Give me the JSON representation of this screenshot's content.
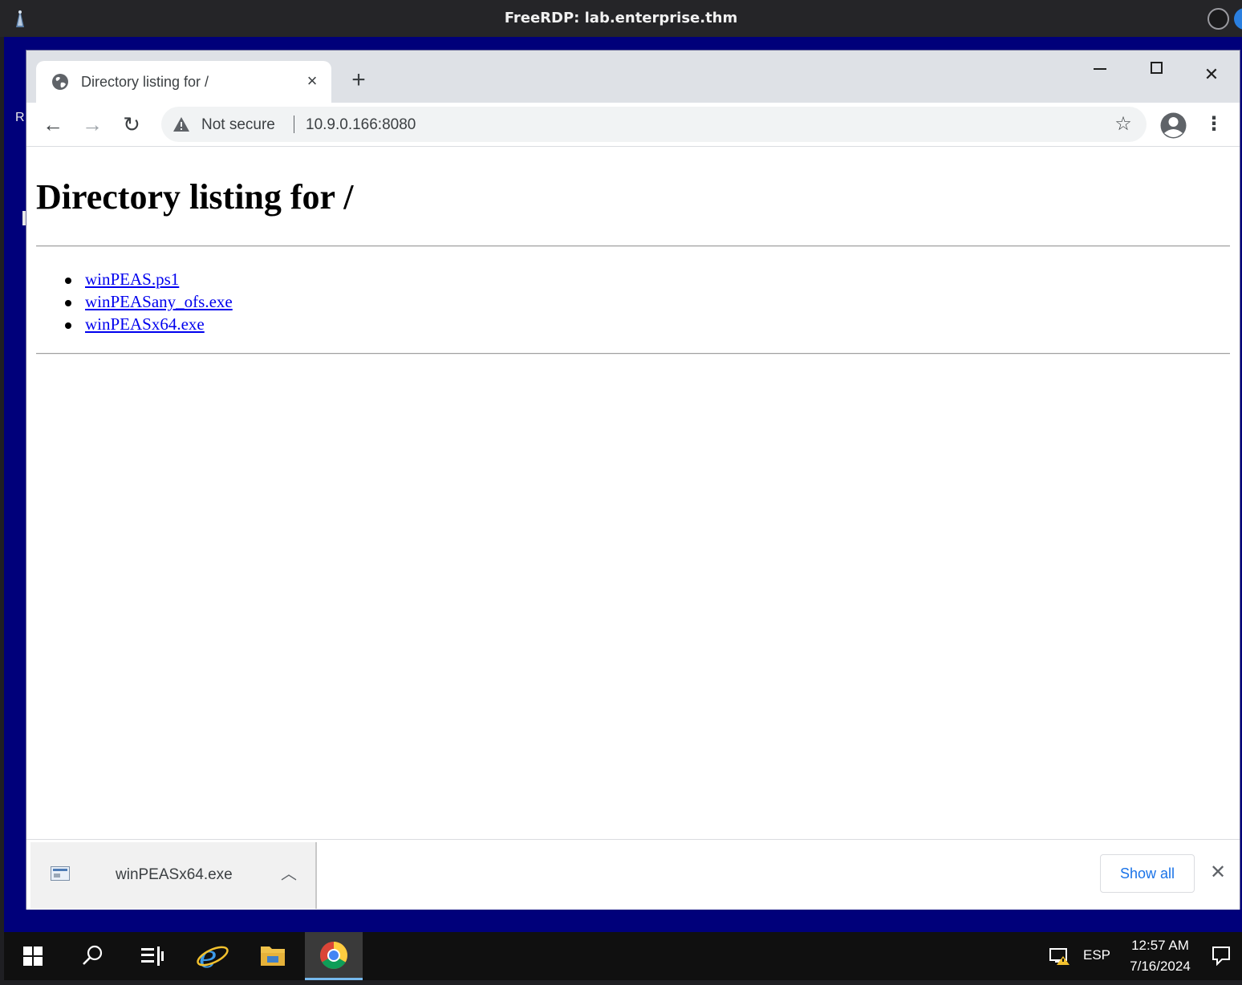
{
  "rdp": {
    "title": "FreeRDP: lab.enterprise.thm"
  },
  "desktop": {
    "edge_glyph": "R"
  },
  "browser": {
    "tab": {
      "title": "Directory listing for /",
      "icon": "globe-icon"
    },
    "window_controls": [
      "minimize",
      "maximize",
      "close"
    ],
    "address_bar": {
      "security_label": "Not secure",
      "url": "10.9.0.166:8080"
    }
  },
  "page": {
    "heading": "Directory listing for /",
    "files": [
      "winPEAS.ps1",
      "winPEASany_ofs.exe",
      "winPEASx64.exe"
    ]
  },
  "download_shelf": {
    "item": {
      "filename": "winPEASx64.exe",
      "icon": "exe-file-icon"
    },
    "show_all_label": "Show all"
  },
  "taskbar": {
    "apps": [
      "start-icon",
      "search-icon",
      "task-view-icon",
      "internet-explorer-icon",
      "file-explorer-icon",
      "chrome-icon"
    ],
    "active_app": "chrome",
    "language": "ESP",
    "time": "12:57 AM",
    "date": "7/16/2024"
  },
  "colors": {
    "desktop_blue": "#00007a",
    "link": "#0000ee",
    "accent": "#1a73e8"
  }
}
